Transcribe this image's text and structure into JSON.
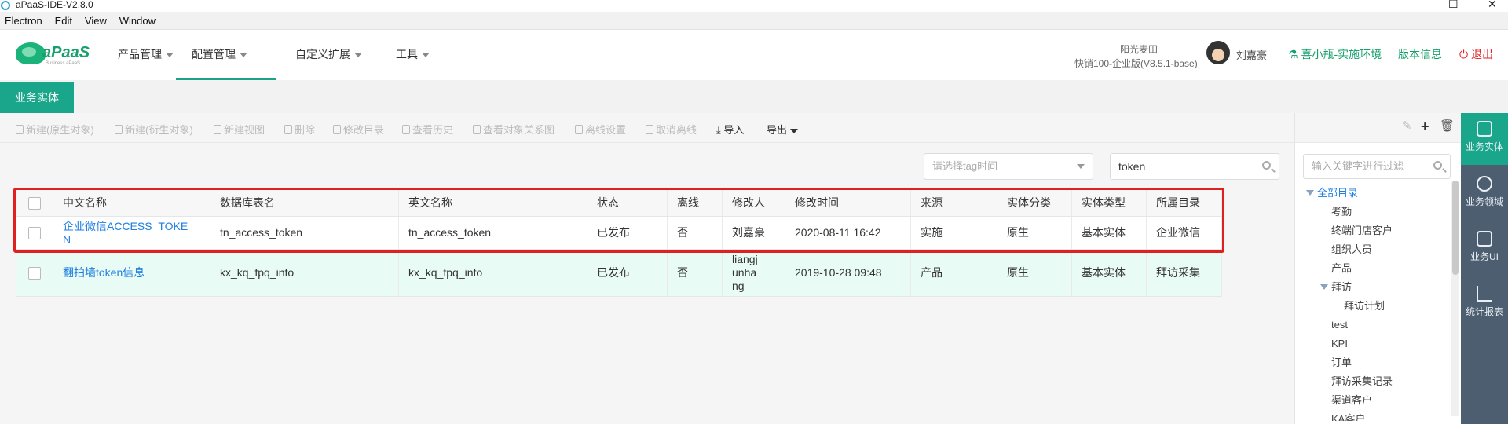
{
  "window": {
    "title": "aPaaS-IDE-V2.8.0",
    "controls": [
      "—",
      "☐",
      "✕"
    ]
  },
  "menubar": [
    "Electron",
    "Edit",
    "View",
    "Window"
  ],
  "header": {
    "logo_text": "aPaaS",
    "logo_sub": "Business aPaaS",
    "nav": [
      {
        "label": "产品管理",
        "active": false
      },
      {
        "label": "配置管理",
        "active": true
      },
      {
        "label": "自定义扩展",
        "active": false
      },
      {
        "label": "工具",
        "active": false
      }
    ],
    "org_name": "阳光麦田",
    "org_edition": "快销100-企业版(V8.5.1-base)",
    "user_name": "刘嘉豪",
    "env_link": "喜小瓶-实施环境",
    "version_link": "版本信息",
    "logout": "退出"
  },
  "tabs": {
    "active": "业务实体"
  },
  "toolbar": {
    "new_native": "新建(原生对象)",
    "new_derived": "新建(衍生对象)",
    "new_view": "新建视图",
    "delete": "删除",
    "edit_dir": "修改目录",
    "history": "查看历史",
    "relation": "查看对象关系图",
    "offline_set": "离线设置",
    "offline_cancel": "取消离线",
    "import": "导入",
    "export": "导出"
  },
  "filters": {
    "tag_time_placeholder": "请选择tag时间",
    "search_value": "token"
  },
  "table": {
    "columns": [
      "中文名称",
      "数据库表名",
      "英文名称",
      "状态",
      "离线",
      "修改人",
      "修改时间",
      "来源",
      "实体分类",
      "实体类型",
      "所属目录"
    ],
    "rows": [
      {
        "cn_name_l1": "企业微信ACCESS_TOKE",
        "cn_name_l2": "N",
        "db_table": "tn_access_token",
        "en_name": "tn_access_token",
        "status": "已发布",
        "offline": "否",
        "modifier_l1": "刘嘉豪",
        "modifier_l2": "",
        "modifier_l3": "",
        "modified_at": "2020-08-11 16:42",
        "source": "实施",
        "category": "原生",
        "type": "基本实体",
        "directory": "企业微信"
      },
      {
        "cn_name_l1": "翻拍墙token信息",
        "cn_name_l2": "",
        "db_table": "kx_kq_fpq_info",
        "en_name": "kx_kq_fpq_info",
        "status": "已发布",
        "offline": "否",
        "modifier_l1": "liangj",
        "modifier_l2": "unha",
        "modifier_l3": "ng",
        "modified_at": "2019-10-28 09:48",
        "source": "产品",
        "category": "原生",
        "type": "基本实体",
        "directory": "拜访采集"
      }
    ]
  },
  "right_panel": {
    "filter_placeholder": "输入关键字进行过滤",
    "tree": [
      {
        "label": "全部目录",
        "level": 0,
        "expanded": true
      },
      {
        "label": "考勤",
        "level": 2
      },
      {
        "label": "终端门店客户",
        "level": 2
      },
      {
        "label": "组织人员",
        "level": 2
      },
      {
        "label": "产品",
        "level": 2
      },
      {
        "label": "拜访",
        "level": 1,
        "expanded": true
      },
      {
        "label": "拜访计划",
        "level": 3
      },
      {
        "label": "test",
        "level": 2
      },
      {
        "label": "KPI",
        "level": 2
      },
      {
        "label": "订单",
        "level": 2
      },
      {
        "label": "拜访采集记录",
        "level": 2
      },
      {
        "label": "渠道客户",
        "level": 2
      },
      {
        "label": "KA客户",
        "level": 2
      }
    ]
  },
  "sidebar": [
    {
      "label": "业务实体",
      "icon": "gear-icon",
      "active": true
    },
    {
      "label": "业务领域",
      "icon": "cubes-icon",
      "active": false
    },
    {
      "label": "业务UI",
      "icon": "ui-icon",
      "active": false
    },
    {
      "label": "统计报表",
      "icon": "chart-icon",
      "active": false
    }
  ]
}
